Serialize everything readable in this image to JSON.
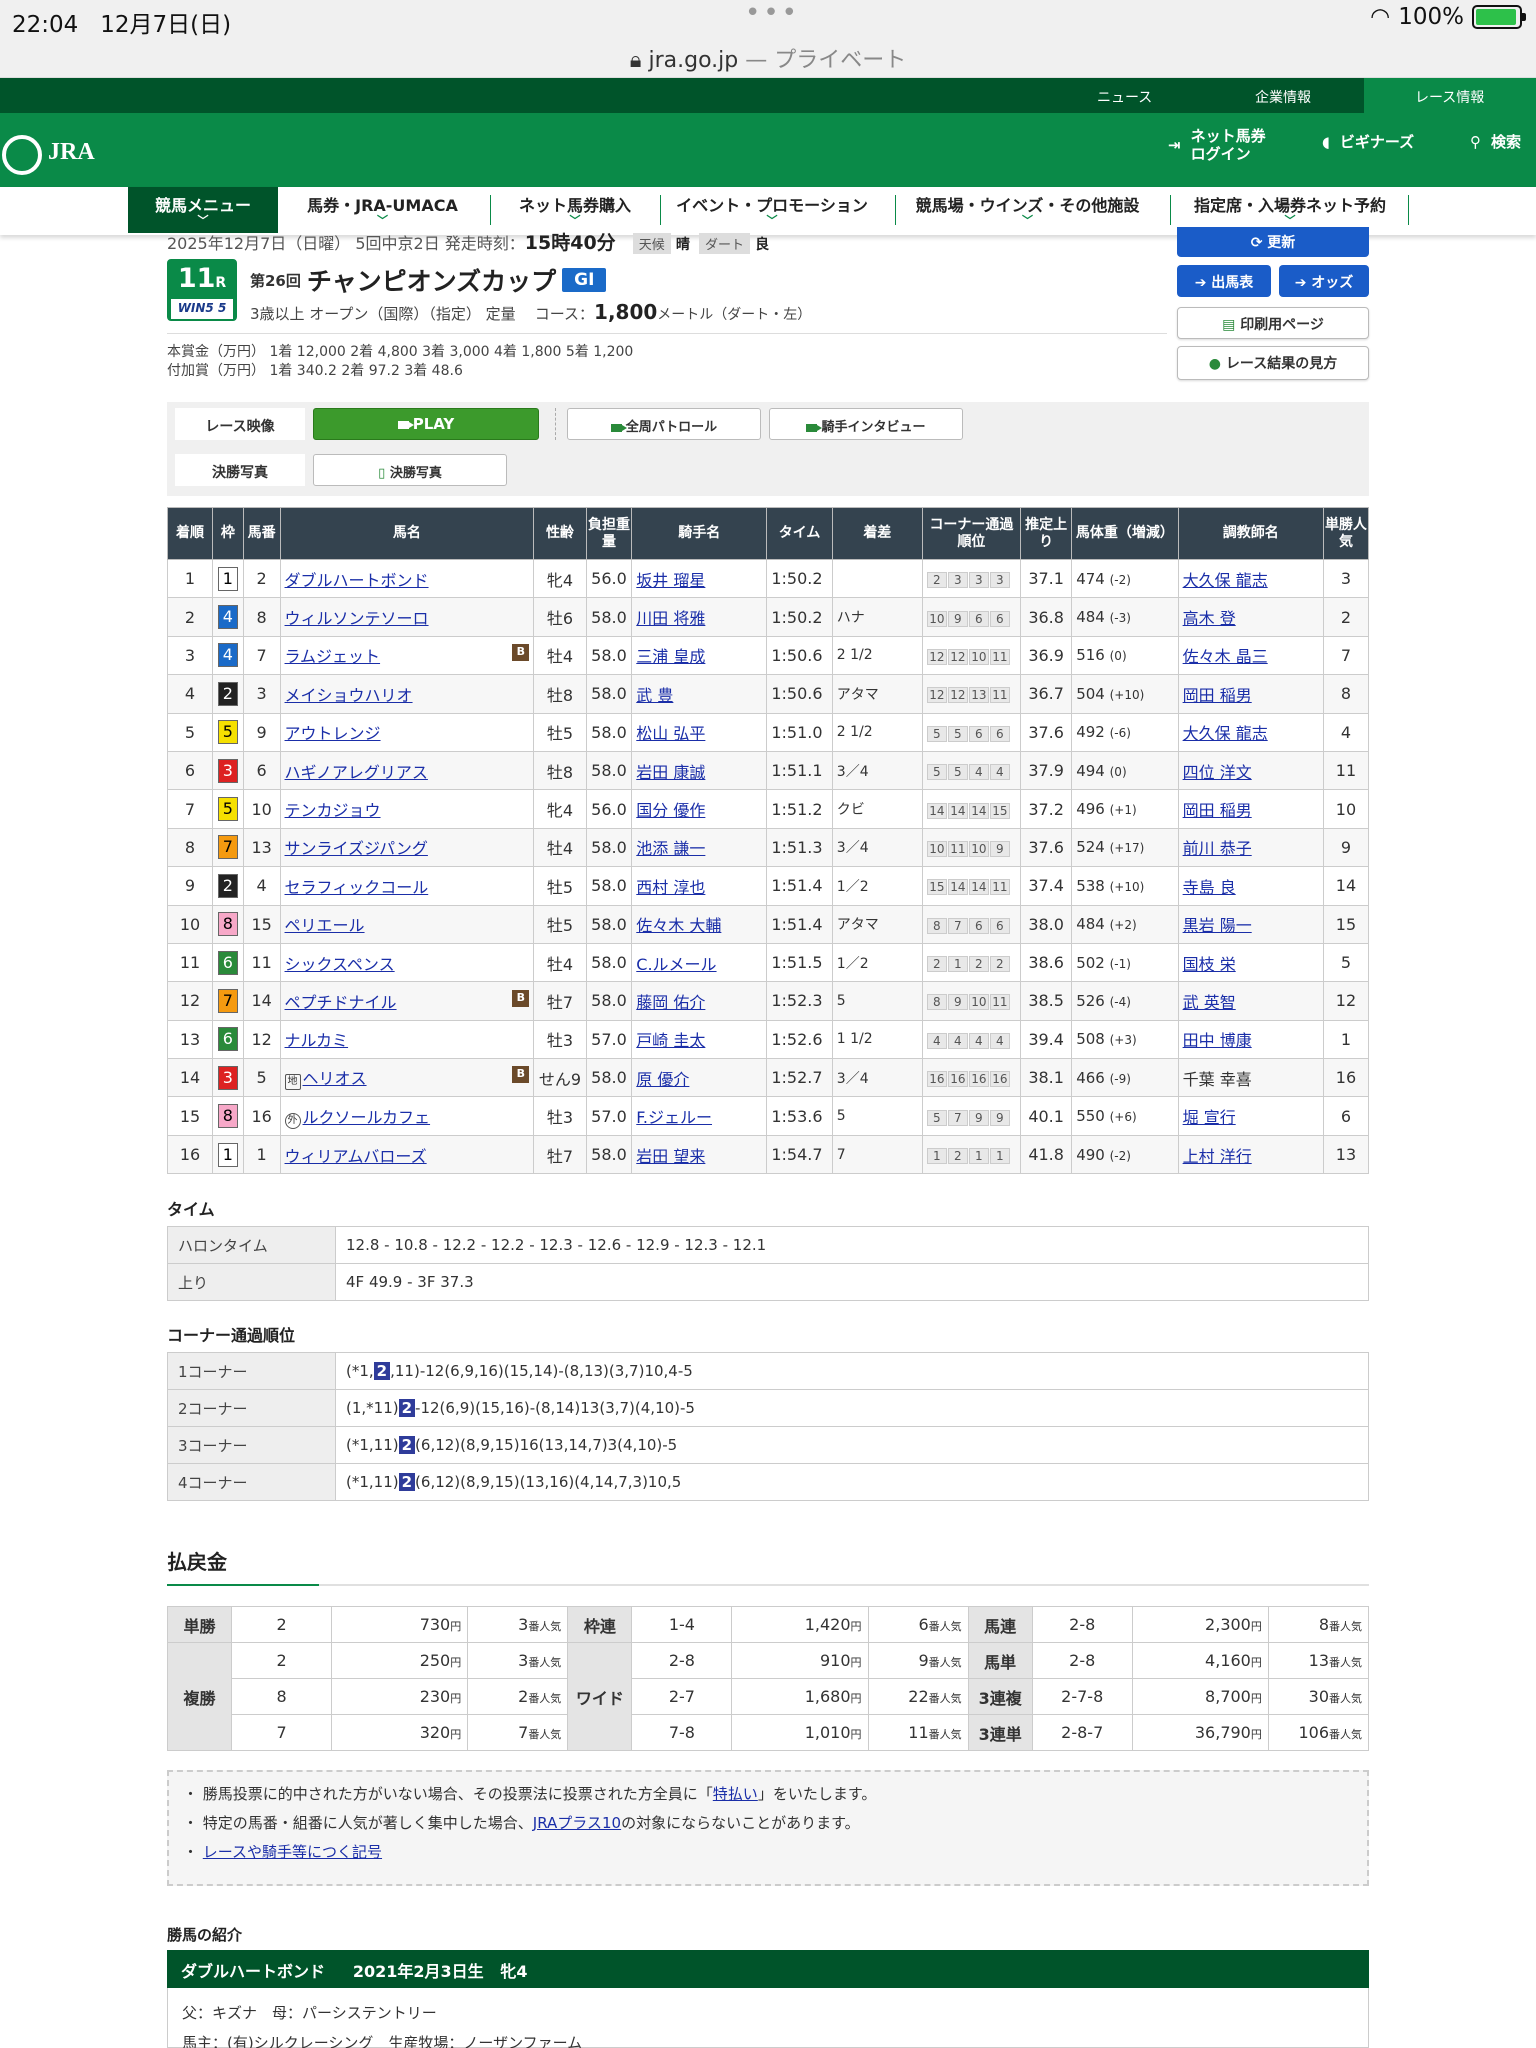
{
  "status": {
    "time": "22:04",
    "date": "12月7日(日)",
    "battery": "100%"
  },
  "browser": {
    "domain": "jra.go.jp",
    "suffix": "— プライベート"
  },
  "top_links": [
    "ニュース",
    "企業情報",
    "レース情報"
  ],
  "header": {
    "logo": "JRA",
    "login_line1": "ネット馬券",
    "login_line2": "ログイン",
    "beginner": "ビギナーズ",
    "search": "検索"
  },
  "nav": [
    "競馬メニュー",
    "馬券・JRA-UMACA",
    "ネット馬券購入",
    "イベント・プロモーション",
    "競馬場・ウインズ・その他施設",
    "指定席・入場券ネット予約"
  ],
  "race": {
    "date_line": "2025年12月7日（日曜） 5回中京2日 発走時刻：",
    "start_time": "15時40分",
    "weather_label": "天候",
    "weather": "晴",
    "surface_label": "ダート",
    "going": "良",
    "race_no": "11",
    "race_suffix": "R",
    "win5": "WIN5 5",
    "edition": "第26回",
    "name": "チャンピオンズカップ",
    "grade": "GI",
    "conditions": "3歳以上 オープン（国際）（指定） 定量",
    "course_label": "コース：",
    "distance": "1,800",
    "course_unit": "メートル（ダート・左）",
    "prize_line1": "本賞金（万円） 1着 12,000  2着 4,800  3着 3,000  4着 1,800  5着 1,200",
    "prize_line2": "付加賞（万円） 1着 340.2  2着 97.2  3着 48.6"
  },
  "side_buttons": {
    "refresh": "更新",
    "entries": "出馬表",
    "odds": "オッズ",
    "print": "印刷用ページ",
    "howto": "レース結果の見方"
  },
  "video": {
    "label1": "レース映像",
    "play": "PLAY",
    "patrol": "全周パトロール",
    "interview": "騎手インタビュー",
    "label2": "決勝写真",
    "photo": "決勝写真"
  },
  "table_headers": [
    "着順",
    "枠",
    "馬番",
    "馬名",
    "性齢",
    "負担重量",
    "騎手名",
    "タイム",
    "着差",
    "コーナー通過順位",
    "推定上り",
    "馬体重（増減）",
    "調教師名",
    "単勝人気"
  ],
  "results": [
    {
      "pos": "1",
      "waku": "1",
      "num": "2",
      "name": "ダブルハートボンド",
      "pre": "",
      "b": false,
      "sex": "牝4",
      "wgt": "56.0",
      "jockey": "坂井 瑠星",
      "time": "1:50.2",
      "margin": "",
      "corner": [
        "2",
        "3",
        "3",
        "3"
      ],
      "last": "37.1",
      "bw": "474",
      "bd": "(-2)",
      "trainer": "大久保 龍志",
      "tlink": true,
      "pop": "3"
    },
    {
      "pos": "2",
      "waku": "4",
      "num": "8",
      "name": "ウィルソンテソーロ",
      "pre": "",
      "b": false,
      "sex": "牡6",
      "wgt": "58.0",
      "jockey": "川田 将雅",
      "time": "1:50.2",
      "margin": "ハナ",
      "corner": [
        "10",
        "9",
        "6",
        "6"
      ],
      "last": "36.8",
      "bw": "484",
      "bd": "(-3)",
      "trainer": "高木 登",
      "tlink": true,
      "pop": "2"
    },
    {
      "pos": "3",
      "waku": "4",
      "num": "7",
      "name": "ラムジェット",
      "pre": "",
      "b": true,
      "sex": "牡4",
      "wgt": "58.0",
      "jockey": "三浦 皇成",
      "time": "1:50.6",
      "margin": "2 1/2",
      "corner": [
        "12",
        "12",
        "10",
        "11"
      ],
      "last": "36.9",
      "bw": "516",
      "bd": "(0)",
      "trainer": "佐々木 晶三",
      "tlink": true,
      "pop": "7"
    },
    {
      "pos": "4",
      "waku": "2",
      "num": "3",
      "name": "メイショウハリオ",
      "pre": "",
      "b": false,
      "sex": "牡8",
      "wgt": "58.0",
      "jockey": "武 豊",
      "time": "1:50.6",
      "margin": "アタマ",
      "corner": [
        "12",
        "12",
        "13",
        "11"
      ],
      "last": "36.7",
      "bw": "504",
      "bd": "(+10)",
      "trainer": "岡田 稲男",
      "tlink": true,
      "pop": "8"
    },
    {
      "pos": "5",
      "waku": "5",
      "num": "9",
      "name": "アウトレンジ",
      "pre": "",
      "b": false,
      "sex": "牡5",
      "wgt": "58.0",
      "jockey": "松山 弘平",
      "time": "1:51.0",
      "margin": "2 1/2",
      "corner": [
        "5",
        "5",
        "6",
        "6"
      ],
      "last": "37.6",
      "bw": "492",
      "bd": "(-6)",
      "trainer": "大久保 龍志",
      "tlink": true,
      "pop": "4"
    },
    {
      "pos": "6",
      "waku": "3",
      "num": "6",
      "name": "ハギノアレグリアス",
      "pre": "",
      "b": false,
      "sex": "牡8",
      "wgt": "58.0",
      "jockey": "岩田 康誠",
      "time": "1:51.1",
      "margin": "3／4",
      "corner": [
        "5",
        "5",
        "4",
        "4"
      ],
      "last": "37.9",
      "bw": "494",
      "bd": "(0)",
      "trainer": "四位 洋文",
      "tlink": true,
      "pop": "11"
    },
    {
      "pos": "7",
      "waku": "5",
      "num": "10",
      "name": "テンカジョウ",
      "pre": "",
      "b": false,
      "sex": "牝4",
      "wgt": "56.0",
      "jockey": "国分 優作",
      "time": "1:51.2",
      "margin": "クビ",
      "corner": [
        "14",
        "14",
        "14",
        "15"
      ],
      "last": "37.2",
      "bw": "496",
      "bd": "(+1)",
      "trainer": "岡田 稲男",
      "tlink": true,
      "pop": "10"
    },
    {
      "pos": "8",
      "waku": "7",
      "num": "13",
      "name": "サンライズジパング",
      "pre": "",
      "b": false,
      "sex": "牡4",
      "wgt": "58.0",
      "jockey": "池添 謙一",
      "time": "1:51.3",
      "margin": "3／4",
      "corner": [
        "10",
        "11",
        "10",
        "9"
      ],
      "last": "37.6",
      "bw": "524",
      "bd": "(+17)",
      "trainer": "前川 恭子",
      "tlink": true,
      "pop": "9"
    },
    {
      "pos": "9",
      "waku": "2",
      "num": "4",
      "name": "セラフィックコール",
      "pre": "",
      "b": false,
      "sex": "牡5",
      "wgt": "58.0",
      "jockey": "西村 淳也",
      "time": "1:51.4",
      "margin": "1／2",
      "corner": [
        "15",
        "14",
        "14",
        "11"
      ],
      "last": "37.4",
      "bw": "538",
      "bd": "(+10)",
      "trainer": "寺島 良",
      "tlink": true,
      "pop": "14"
    },
    {
      "pos": "10",
      "waku": "8",
      "num": "15",
      "name": "ペリエール",
      "pre": "",
      "b": false,
      "sex": "牡5",
      "wgt": "58.0",
      "jockey": "佐々木 大輔",
      "time": "1:51.4",
      "margin": "アタマ",
      "corner": [
        "8",
        "7",
        "6",
        "6"
      ],
      "last": "38.0",
      "bw": "484",
      "bd": "(+2)",
      "trainer": "黒岩 陽一",
      "tlink": true,
      "pop": "15"
    },
    {
      "pos": "11",
      "waku": "6",
      "num": "11",
      "name": "シックスペンス",
      "pre": "",
      "b": false,
      "sex": "牡4",
      "wgt": "58.0",
      "jockey": "C.ルメール",
      "time": "1:51.5",
      "margin": "1／2",
      "corner": [
        "2",
        "1",
        "2",
        "2"
      ],
      "last": "38.6",
      "bw": "502",
      "bd": "(-1)",
      "trainer": "国枝 栄",
      "tlink": true,
      "pop": "5"
    },
    {
      "pos": "12",
      "waku": "7",
      "num": "14",
      "name": "ペプチドナイル",
      "pre": "",
      "b": true,
      "sex": "牡7",
      "wgt": "58.0",
      "jockey": "藤岡 佑介",
      "time": "1:52.3",
      "margin": "5",
      "corner": [
        "8",
        "9",
        "10",
        "11"
      ],
      "last": "38.5",
      "bw": "526",
      "bd": "(-4)",
      "trainer": "武 英智",
      "tlink": true,
      "pop": "12"
    },
    {
      "pos": "13",
      "waku": "6",
      "num": "12",
      "name": "ナルカミ",
      "pre": "",
      "b": false,
      "sex": "牡3",
      "wgt": "57.0",
      "jockey": "戸崎 圭太",
      "time": "1:52.6",
      "margin": "1 1/2",
      "corner": [
        "4",
        "4",
        "4",
        "4"
      ],
      "last": "39.4",
      "bw": "508",
      "bd": "(+3)",
      "trainer": "田中 博康",
      "tlink": true,
      "pop": "1"
    },
    {
      "pos": "14",
      "waku": "3",
      "num": "5",
      "name": "ヘリオス",
      "pre": "地",
      "b": true,
      "sex": "せん9",
      "wgt": "58.0",
      "jockey": "原 優介",
      "time": "1:52.7",
      "margin": "3／4",
      "corner": [
        "16",
        "16",
        "16",
        "16"
      ],
      "last": "38.1",
      "bw": "466",
      "bd": "(-9)",
      "trainer": "千葉 幸喜",
      "tlink": false,
      "pop": "16"
    },
    {
      "pos": "15",
      "waku": "8",
      "num": "16",
      "name": "ルクソールカフェ",
      "pre": "外",
      "b": false,
      "sex": "牡3",
      "wgt": "57.0",
      "jockey": "F.ジェルー",
      "time": "1:53.6",
      "margin": "5",
      "corner": [
        "5",
        "7",
        "9",
        "9"
      ],
      "last": "40.1",
      "bw": "550",
      "bd": "(+6)",
      "trainer": "堀 宣行",
      "tlink": true,
      "pop": "6"
    },
    {
      "pos": "16",
      "waku": "1",
      "num": "1",
      "name": "ウィリアムバローズ",
      "pre": "",
      "b": false,
      "sex": "牡7",
      "wgt": "58.0",
      "jockey": "岩田 望来",
      "time": "1:54.7",
      "margin": "7",
      "corner": [
        "1",
        "2",
        "1",
        "1"
      ],
      "last": "41.8",
      "bw": "490",
      "bd": "(-2)",
      "trainer": "上村 洋行",
      "tlink": true,
      "pop": "13"
    }
  ],
  "time_section": {
    "title": "タイム",
    "rows": [
      {
        "k": "ハロンタイム",
        "v": "12.8 - 10.8 - 12.2 - 12.2 - 12.3 - 12.6 - 12.9 - 12.3 - 12.1"
      },
      {
        "k": "上り",
        "v": "4F 49.9 - 3F 37.3"
      }
    ]
  },
  "corner_section": {
    "title": "コーナー通過順位",
    "rows": [
      {
        "k": "1コーナー",
        "pre": "(*1,",
        "hl": "2",
        "post": ",11)-12(6,9,16)(15,14)-(8,13)(3,7)10,4-5"
      },
      {
        "k": "2コーナー",
        "pre": "(1,*11)",
        "hl": "2",
        "post": "-12(6,9)(15,16)-(8,14)13(3,7)(4,10)-5"
      },
      {
        "k": "3コーナー",
        "pre": "(*1,11)",
        "hl": "2",
        "post": "(6,12)(8,9,15)16(13,14,7)3(4,10)-5"
      },
      {
        "k": "4コーナー",
        "pre": "(*1,11)",
        "hl": "2",
        "post": "(6,12)(8,9,15)(13,16)(4,14,7,3)10,5"
      }
    ]
  },
  "payout": {
    "title": "払戻金",
    "rows": [
      {
        "t1": "単勝",
        "n1": "2",
        "m1": "730",
        "p1": "3",
        "t2": "枠連",
        "n2": "1-4",
        "m2": "1,420",
        "p2": "6",
        "t3": "馬連",
        "n3": "2-8",
        "m3": "2,300",
        "p3": "8"
      },
      {
        "t1": "複勝",
        "n1": "2",
        "m1": "250",
        "p1": "3",
        "t2": "ワイド",
        "n2": "2-8",
        "m2": "910",
        "p2": "9",
        "t3": "馬単",
        "n3": "2-8",
        "m3": "4,160",
        "p3": "13"
      },
      {
        "t1": "",
        "n1": "8",
        "m1": "230",
        "p1": "2",
        "t2": "",
        "n2": "2-7",
        "m2": "1,680",
        "p2": "22",
        "t3": "3連複",
        "n3": "2-7-8",
        "m3": "8,700",
        "p3": "30"
      },
      {
        "t1": "",
        "n1": "7",
        "m1": "320",
        "p1": "7",
        "t2": "",
        "n2": "7-8",
        "m2": "1,010",
        "p2": "11",
        "t3": "3連単",
        "n3": "2-8-7",
        "m3": "36,790",
        "p3": "106"
      }
    ],
    "yen": "円",
    "pop_suffix": "番人気"
  },
  "notes": {
    "n1_a": "勝馬投票に的中された方がいない場合、その投票法に投票された方全員に「",
    "n1_link": "特払い",
    "n1_b": "」をいたします。",
    "n2_a": "特定の馬番・組番に人気が著しく集中した場合、",
    "n2_link": "JRAプラス10",
    "n2_b": "の対象にならないことがあります。",
    "n3_link": "レースや騎手等につく記号"
  },
  "winner": {
    "title": "勝馬の紹介",
    "name": "ダブルハートボンド",
    "birth": "2021年2月3日生",
    "sex": "牝4",
    "line1": "父：キズナ　母：パーシステントリー",
    "line2": "馬主：(有)シルクレーシング　生産牧場：ノーザンファーム"
  }
}
